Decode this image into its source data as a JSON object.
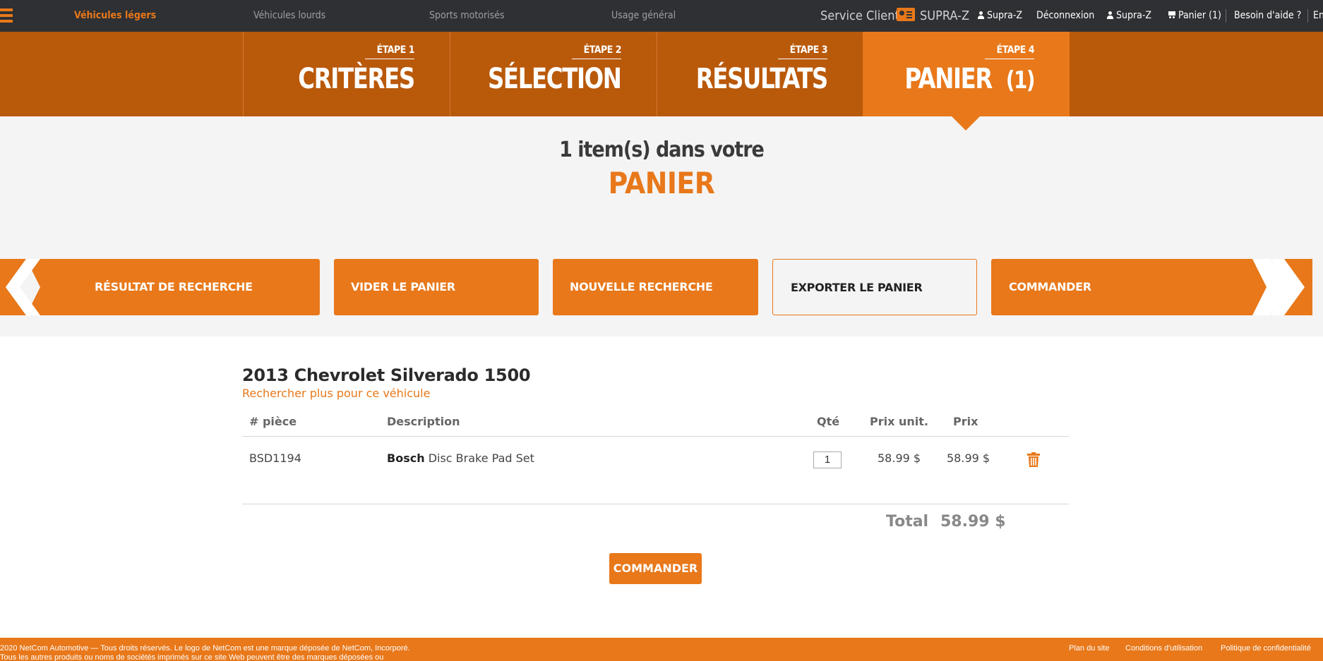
{
  "colors": {
    "accent": "#e8781a",
    "accent_dark": "#b9590a",
    "topbar": "#2f3033",
    "hero_bg": "#f4f4f4"
  },
  "topnav": {
    "items": [
      "Véhicules légers",
      "Véhicules lourds",
      "Sports motorisés",
      "Usage général"
    ],
    "service_label": "Service Client :",
    "service_name": "SUPRA-Z",
    "user1": "Supra-Z",
    "logout": "Déconnexion",
    "user2": "Supra-Z",
    "cart": "Panier (1)",
    "help": "Besoin d'aide ?",
    "lang": "En"
  },
  "steps": [
    {
      "num": "ÉTAPE 1",
      "title": "CRITÈRES"
    },
    {
      "num": "ÉTAPE 2",
      "title": "SÉLECTION"
    },
    {
      "num": "ÉTAPE 3",
      "title": "RÉSULTATS"
    },
    {
      "num": "ÉTAPE 4",
      "title": "PANIER",
      "count": "(1)"
    }
  ],
  "hero": {
    "line1": "1 item(s) dans votre",
    "line2": "PANIER"
  },
  "actions": {
    "back": "RÉSULTAT DE RECHERCHE",
    "clear": "VIDER LE PANIER",
    "new_search": "NOUVELLE RECHERCHE",
    "export": "EXPORTER LE PANIER",
    "order": "COMMANDER"
  },
  "cart": {
    "vehicle": "2013 Chevrolet Silverado 1500",
    "more_link": "Rechercher plus pour ce véhicule",
    "headers": {
      "part": "# pièce",
      "desc": "Description",
      "qty": "Qté",
      "unit": "Prix unit.",
      "price": "Prix"
    },
    "rows": [
      {
        "part": "BSD1194",
        "brand": "Bosch",
        "desc": "Disc Brake Pad Set",
        "qty": "1",
        "unit": "58.99 $",
        "price": "58.99 $"
      }
    ],
    "total_label": "Total",
    "total_value": "58.99 $",
    "order_button": "COMMANDER"
  },
  "footer": {
    "copy1": "2020 NetCom Automotive — Tous droits réservés. Le logo de NetCom est une marque déposée de NetCom, Incorporé.",
    "copy2": "Tous les autres produits ou noms de sociétés imprimés sur ce site Web peuvent être des marques déposées ou",
    "links": [
      "Plan du site",
      "Conditions d'utilisation",
      "Politique de confidentialité"
    ]
  }
}
